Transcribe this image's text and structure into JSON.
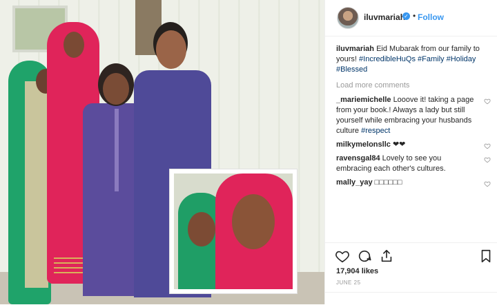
{
  "post": {
    "username": "iluvmariah",
    "verified_icon": "verified-badge-icon",
    "separator": "•",
    "follow_label": "Follow"
  },
  "caption": {
    "username": "iluvmariah",
    "text": "Eid Mubarak from our family to yours!",
    "hashtags": [
      "#IncredibleHuQs",
      "#Family",
      "#Holiday",
      "#Blessed"
    ]
  },
  "load_more": "Load more comments",
  "comments": [
    {
      "username": "_mariemichelle",
      "text": "Looove it! taking a page from your book.! Always a lady but still yourself while embracing your husbands culture ",
      "hashtag": "#respect"
    },
    {
      "username": "milkymelonsllc",
      "text": "❤❤",
      "hashtag": ""
    },
    {
      "username": "ravensgal84",
      "text": "Lovely to see you embracing each other's cultures.",
      "hashtag": ""
    },
    {
      "username": "mally_yay",
      "text": "□□□□□□",
      "hashtag": ""
    }
  ],
  "likes": "17,904 likes",
  "date": "JUNE 25",
  "colors": {
    "link": "#3897f0",
    "hashtag": "#003569",
    "muted": "#999999"
  }
}
